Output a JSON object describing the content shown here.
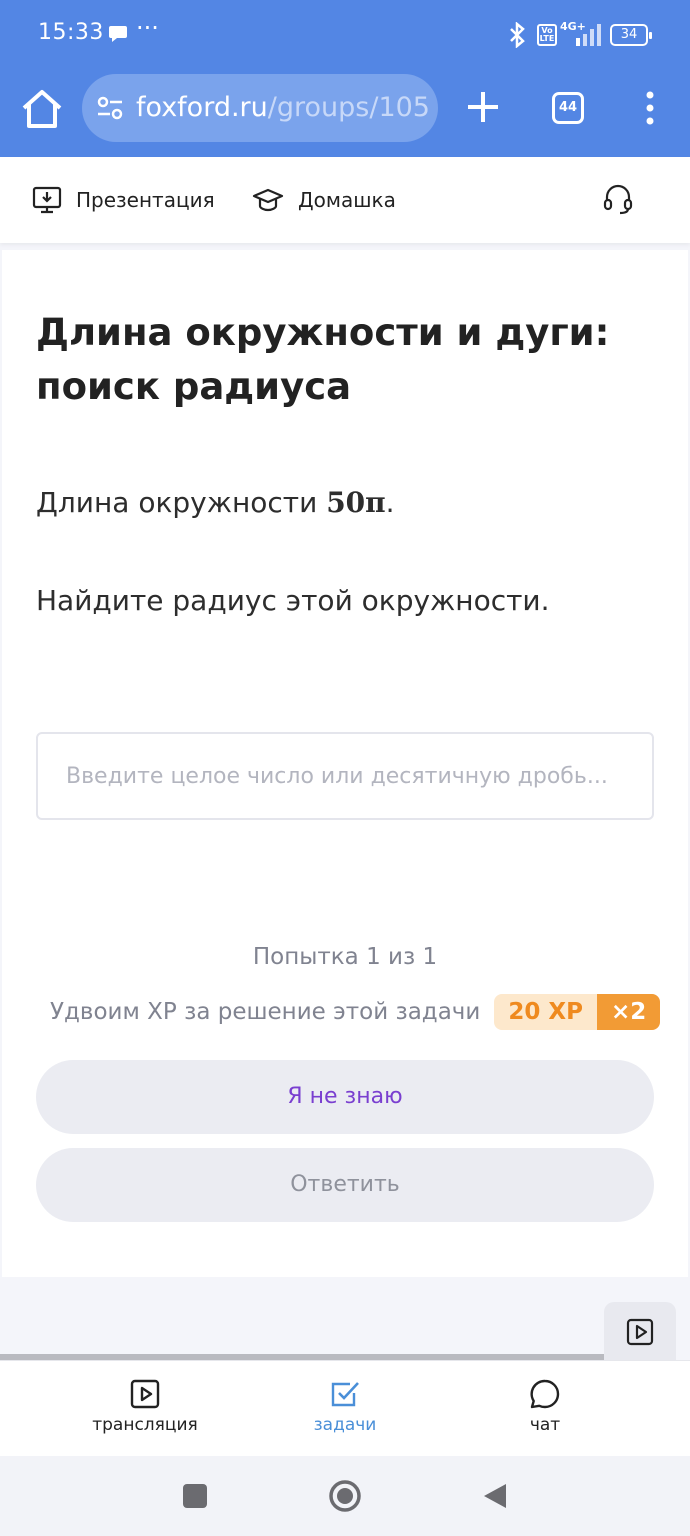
{
  "status_bar": {
    "time": "15:33",
    "network": "4G+",
    "volte": "Vo LTE",
    "battery": "34"
  },
  "browser": {
    "url_domain": "foxford.ru",
    "url_path": "/groups/105",
    "tabs_count": "44"
  },
  "subnav": {
    "presentation_label": "Презентация",
    "homework_label": "Домашка"
  },
  "task": {
    "title": "Длина окружности и дуги: поиск радиуса",
    "question_prefix": "Длина окружности ",
    "question_math": "50π",
    "question_suffix": ".",
    "question_line2": "Найдите радиус этой окружности.",
    "answer_placeholder": "Введите целое число или десятичную дробь...",
    "answer_value": "",
    "attempt_text": "Попытка 1 из 1",
    "xp_label": "Удвоим XP за решение этой задачи",
    "xp_value": "20 XP",
    "xp_multiplier": "×2",
    "dont_know_label": "Я не знаю",
    "submit_label": "Ответить"
  },
  "bottom_tabs": [
    {
      "label": "трансляция",
      "icon": "play-square-icon"
    },
    {
      "label": "задачи",
      "icon": "checkbox-icon",
      "active": true
    },
    {
      "label": "чат",
      "icon": "chat-bubble-icon"
    }
  ],
  "colors": {
    "browser_bar": "#5386e4",
    "active_tab": "#4a8fd8",
    "dont_know_text": "#7a3fd0",
    "xp_orange": "#f29b35"
  }
}
